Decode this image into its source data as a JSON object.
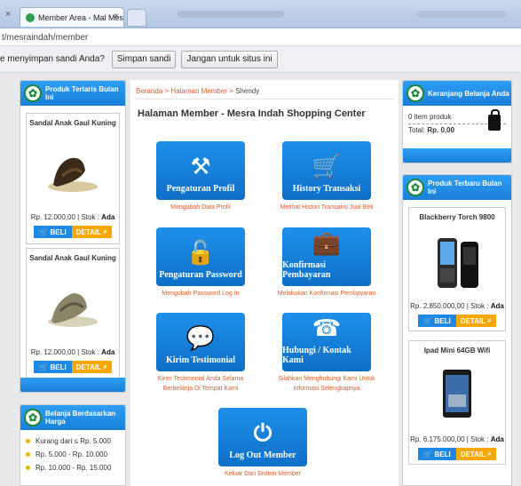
{
  "browser": {
    "tab_close_left": "×",
    "tab_title": "Member Area - Mal Mesra",
    "tab_close": "×",
    "address": "t/mesraindah/member",
    "save_prompt": "e menyimpan sandi Anda?",
    "save_btn": "Simpan sandi",
    "never_btn": "Jangan untuk situs ini"
  },
  "left": {
    "bestseller_title": "Produk Terlaris Bulan Ini",
    "products": [
      {
        "name": "Sandal Anak Gaul Kuning",
        "price": "Rp. 12.000,00 | Stok :",
        "stock": "Ada",
        "beli": "BELI",
        "detail": "DETAIL"
      },
      {
        "name": "Sandal Anak Gaul Kuning",
        "price": "Rp. 12.000,00 | Stok :",
        "stock": "Ada",
        "beli": "BELI",
        "detail": "DETAIL"
      }
    ],
    "price_title": "Belanja Berdasarkan Harga",
    "price_ranges": [
      "Kurang dari ≤ Rp. 5.000",
      "Rp. 5.000 - Rp. 10.000",
      "Rp. 10.000 - Rp. 15.000"
    ]
  },
  "center": {
    "crumb_home": "Beranda",
    "crumb_sep": " > ",
    "crumb_member": "Halaman Member",
    "crumb_current": "Shendy",
    "title": "Halaman Member - Mesra Indah Shopping Center",
    "tiles": [
      {
        "label": "Pengaturan Profil",
        "caption": "Mengubah Data Profil"
      },
      {
        "label": "History Transaksi",
        "caption": "Melihat Histori Transaksi Jual Beli"
      },
      {
        "label": "Pengaturan Password",
        "caption": "Mengubah Password Log In"
      },
      {
        "label": "Konfirmasi Pembayaran",
        "caption": "Melakukan Konfirmasi Pembayaran"
      },
      {
        "label": "Kirim Testimonial",
        "caption": "Kirim Testimonial Anda Selama Berbelanja Di Tempat Kami"
      },
      {
        "label": "Hubungi / Kontak Kami",
        "caption": "Silahkan Menghubungi Kami Untuk Informasi Selengkapnya"
      },
      {
        "label": "Log Out Member",
        "caption": "Keluar Dari Sistem Member"
      }
    ]
  },
  "right": {
    "cart_title": "Keranjang Belanja Anda",
    "cart_items": "0 item produk",
    "cart_total_label": "Total:",
    "cart_total": "Rp. 0,00",
    "newest_title": "Produk Terbaru Bulan Ini",
    "products": [
      {
        "name": "Blackberry Torch 9800",
        "price": "Rp. 2.850.000,00 | Stok :",
        "stock": "Ada",
        "beli": "BELI",
        "detail": "DETAIL"
      },
      {
        "name": "Ipad Mini 64GB Wifi",
        "price": "Rp. 6.175.000,00 | Stok :",
        "stock": "Ada",
        "beli": "BELI",
        "detail": "DETAIL"
      }
    ]
  }
}
